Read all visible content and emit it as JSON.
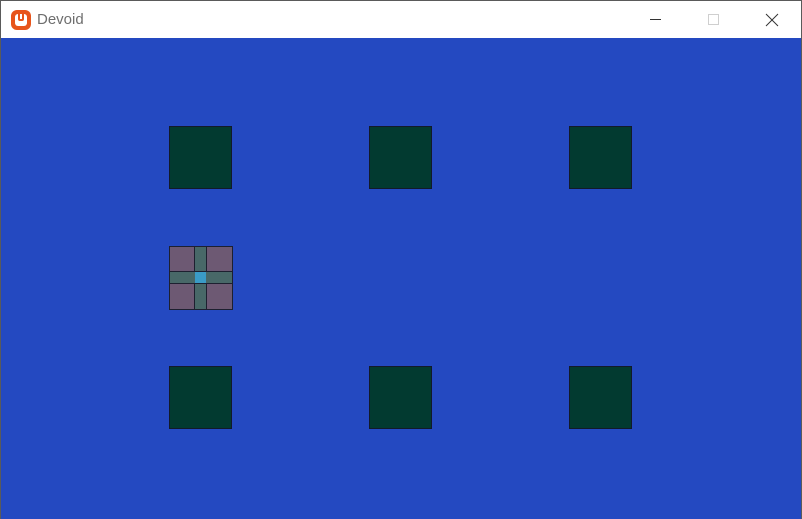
{
  "window": {
    "title": "Devoid",
    "app_icon": "monogame-icon",
    "controls": [
      "minimize-icon",
      "maximize-icon",
      "close-icon"
    ]
  },
  "game": {
    "background_color": "#2449c1",
    "tile_color": "#023a30",
    "grid": {
      "rows": [
        [
          "tile",
          "tile",
          "tile"
        ],
        [
          "player",
          "empty",
          "empty"
        ],
        [
          "tile",
          "tile",
          "tile"
        ]
      ]
    },
    "player": {
      "body_color": "#6d5973",
      "cross_color": "#486868",
      "center_color": "#3a9bc6"
    }
  }
}
